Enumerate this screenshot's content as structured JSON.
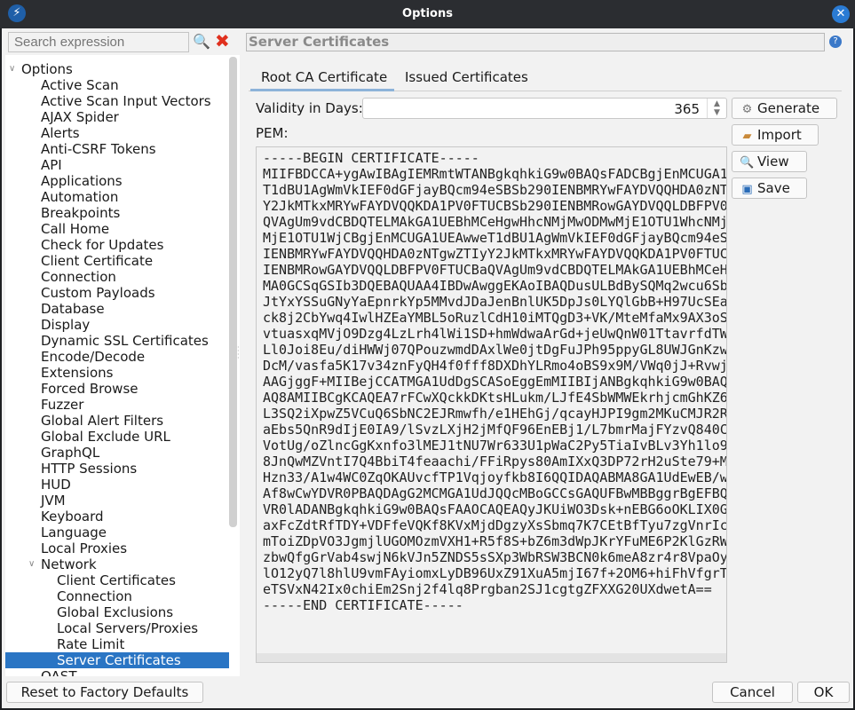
{
  "window": {
    "title": "Options",
    "close_icon": "close-icon",
    "logo": "zap-logo"
  },
  "sidebar": {
    "search_placeholder": "Search expression",
    "tree": [
      {
        "label": "Options",
        "level": 0,
        "expanded": true
      },
      {
        "label": "Active Scan",
        "level": 1
      },
      {
        "label": "Active Scan Input Vectors",
        "level": 1
      },
      {
        "label": "AJAX Spider",
        "level": 1
      },
      {
        "label": "Alerts",
        "level": 1
      },
      {
        "label": "Anti-CSRF Tokens",
        "level": 1
      },
      {
        "label": "API",
        "level": 1
      },
      {
        "label": "Applications",
        "level": 1
      },
      {
        "label": "Automation",
        "level": 1
      },
      {
        "label": "Breakpoints",
        "level": 1
      },
      {
        "label": "Call Home",
        "level": 1
      },
      {
        "label": "Check for Updates",
        "level": 1
      },
      {
        "label": "Client Certificate",
        "level": 1
      },
      {
        "label": "Connection",
        "level": 1
      },
      {
        "label": "Custom Payloads",
        "level": 1
      },
      {
        "label": "Database",
        "level": 1
      },
      {
        "label": "Display",
        "level": 1
      },
      {
        "label": "Dynamic SSL Certificates",
        "level": 1
      },
      {
        "label": "Encode/Decode",
        "level": 1
      },
      {
        "label": "Extensions",
        "level": 1
      },
      {
        "label": "Forced Browse",
        "level": 1
      },
      {
        "label": "Fuzzer",
        "level": 1
      },
      {
        "label": "Global Alert Filters",
        "level": 1
      },
      {
        "label": "Global Exclude URL",
        "level": 1
      },
      {
        "label": "GraphQL",
        "level": 1
      },
      {
        "label": "HTTP Sessions",
        "level": 1
      },
      {
        "label": "HUD",
        "level": 1
      },
      {
        "label": "JVM",
        "level": 1
      },
      {
        "label": "Keyboard",
        "level": 1
      },
      {
        "label": "Language",
        "level": 1
      },
      {
        "label": "Local Proxies",
        "level": 1
      },
      {
        "label": "Network",
        "level": 1,
        "expanded": true
      },
      {
        "label": "Client Certificates",
        "level": 2
      },
      {
        "label": "Connection",
        "level": 2
      },
      {
        "label": "Global Exclusions",
        "level": 2
      },
      {
        "label": "Local Servers/Proxies",
        "level": 2
      },
      {
        "label": "Rate Limit",
        "level": 2
      },
      {
        "label": "Server Certificates",
        "level": 2,
        "selected": true
      },
      {
        "label": "OAST",
        "level": 1
      }
    ]
  },
  "panel": {
    "title": "Server Certificates",
    "tabs": [
      {
        "label": "Root CA Certificate",
        "active": true
      },
      {
        "label": "Issued Certificates"
      }
    ],
    "validity_label": "Validity in Days:",
    "validity_value": "365",
    "pem_label": "PEM:",
    "buttons": {
      "generate": "Generate",
      "import": "Import",
      "view": "View",
      "save": "Save"
    },
    "pem_text": "-----BEGIN CERTIFICATE-----\nMIIFBDCCA+ygAwIBAgIEMRmtWTANBgkqhkiG9w0BAQsFADCBgjEnMCUGA1\nT1dBU1AgWmVkIEF0dGFjayBQcm94eSBSb290IENBMRYwFAYDVQQHDA0zNT\nY2JkMTkxMRYwFAYDVQQKDA1PV0FTUCBSb290IENBMRowGAYDVQQLDBFPV0\nQVAgUm9vdCBDQTELMAkGA1UEBhMCeHgwHhcNMjMwODMwMjE1OTU1WhcNMj\nMjE1OTU1WjCBgjEnMCUGA1UEAwweT1dBU1AgWmVkIEF0dGFjayBQcm94eS\nIENBMRYwFAYDVQQHDA0zNTgwZTIyY2JkMTkxMRYwFAYDVQQKDA1PV0FTUC\nIENBMRowGAYDVQQLDBFPV0FTUCBaQVAgUm9vdCBDQTELMAkGA1UEBhMCeH\nMA0GCSqGSIb3DQEBAQUAA4IBDwAwggEKAoIBAQDusULBdBySQMq2wcu6Sb\nJtYxYSSuGNyYaEpnrkYp5MMvdJDaJenBnlUK5DpJs0LYQlGbB+H97UcSEa\nck8j2CbYwq4IwlHZEaYMBL5oRuzlCdH10iMTQgD3+VK/MteMfaMx9AX3oS\nvtuasxqMVjO9Dzg4LzLrh4lWi1SD+hmWdwaArGd+jeUwQnW01TtavrfdTW\nLl0Joi8Eu/diHWWj07QPouzwmdDAxlWe0jtDgFuJPh95ppyGL8UWJGnKzw\nDcM/vasfa5K17v34znFyQH4f0fff8DXDhYLRmo4oBS9x9M/VWq0jJ+Rvwj\nAAGjggF+MIIBejCCATMGA1UdDgSCASoEggEmMIIBIjANBgkqhkiG9w0BAQ\nAQ8AMIIBCgKCAQEA7rFCwXQckkDKtsHLukm/LJfE4SbWMWEkrhjcmGhKZ6\nL3SQ2iXpwZ5VCuQ6SbNC2EJRmwfh/e1HEhGj/qcayHJPI9gm2MKuCMJR2R\naEbs5QnR9dIjE0IA9/lSvzLXjH2jMfQF96EnEBj1/L7bmrMajFYzvQ840C\nVotUg/oZlncGgKxnfo3lMEJ1tNU7Wr633U1pWaC2Py5TiaIvBLv3Yh1lo9\n8JnQwMZVntI7Q4BbiT4feaachi/FFiRpys80AmIXxQ3DP72rH2uSte79+M\nHzn33/A1w4WC0ZqOKAUvcfTP1Vqjoyfkb8I6QQIDAQABMA8GA1UdEwEB/w\nAf8wCwYDVR0PBAQDAgG2MCMGA1UdJQQcMBoGCCsGAQUFBwMBBggrBgEFBQ\nVR0lADANBgkqhkiG9w0BAQsFAAOCAQEAQyJKUiWO3Dsk+nEBG6oOKLIX0G\naxFcZdtRfTDY+VDFfeVQKf8KVxMjdDgzyXsSbmq7K7CEtBfTyu7zgVnrIc\nmToiZDpVO3JgmjlUGOMOzmVXH1+R5f8S+bZ6m3dWpJKrYFuME6P2KlGzRW\nzbwQfgGrVab4swjN6kVJn5ZNDS5sSXp3WbRSW3BCN0k6meA8zr4r8VpaOy\nlO12yQ7l8hlU9vmFAyiomxLyDB96UxZ91XuA5mjI67f+2OM6+hiFhVfgrT\neTSVxN42Ix0chiEm2Snj2f4lq8Prgban2SJ1cgtgZFXXG20UXdwetA==\n-----END CERTIFICATE-----"
  },
  "footer": {
    "reset": "Reset to Factory Defaults",
    "cancel": "Cancel",
    "ok": "OK"
  },
  "colors": {
    "selection": "#2a75c4",
    "titlebar": "#2b2d31",
    "accent": "#2a7bd4"
  }
}
